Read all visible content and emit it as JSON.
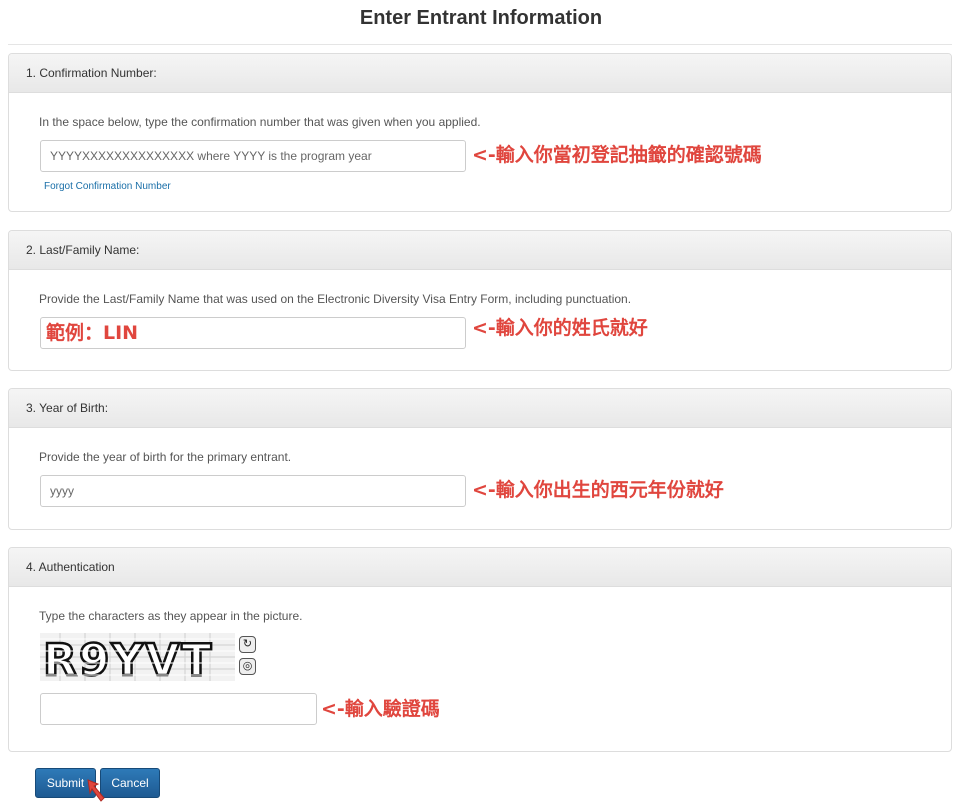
{
  "page": {
    "title": "Enter Entrant Information"
  },
  "confirmation": {
    "heading": "1. Confirmation Number:",
    "help": "In the space below, type the confirmation number that was given when you applied.",
    "placeholder": "YYYYXXXXXXXXXXXXXX where YYYY is the program year",
    "forgot_link": "Forgot Confirmation Number",
    "annotation": "<-輸入你當初登記抽籤的確認號碼"
  },
  "last_name": {
    "heading": "2. Last/Family Name:",
    "help": "Provide the Last/Family Name that was used on the Electronic Diversity Visa Entry Form, including punctuation.",
    "example_value": "範例：LIN",
    "annotation": "<-輸入你的姓氏就好"
  },
  "birth_year": {
    "heading": "3. Year of Birth:",
    "help": "Provide the year of birth for the primary entrant.",
    "placeholder": "yyyy",
    "annotation": "<-輸入你出生的西元年份就好"
  },
  "authentication": {
    "heading": "4. Authentication",
    "help": "Type the characters as they appear in the picture.",
    "captcha_text": "R9YVT",
    "refresh_icon": "refresh-icon",
    "audio_icon": "audio-icon",
    "input_value": "",
    "annotation": "<-輸入驗證碼"
  },
  "buttons": {
    "submit": "Submit",
    "cancel": "Cancel"
  },
  "colors": {
    "annotation": "#e0463e",
    "button": "#1e5a92",
    "link": "#1a6fa8"
  }
}
